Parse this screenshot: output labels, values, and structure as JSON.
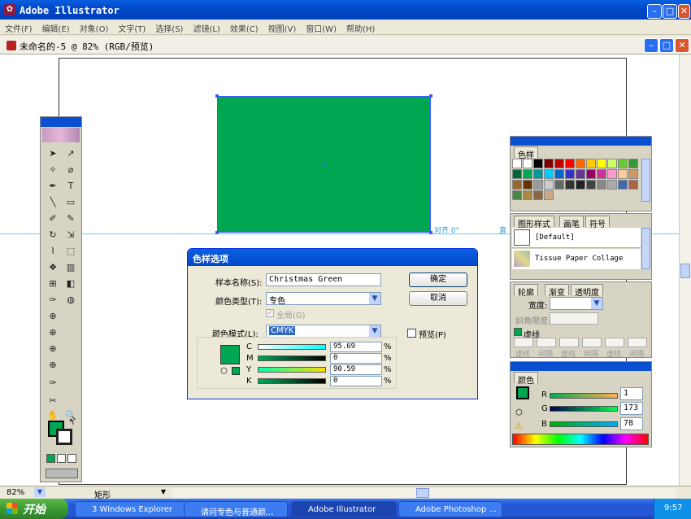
{
  "app": {
    "title": "Adobe Illustrator"
  },
  "menu": [
    "文件(F)",
    "编辑(E)",
    "对象(O)",
    "文字(T)",
    "选择(S)",
    "滤镜(L)",
    "效果(C)",
    "视图(V)",
    "窗口(W)",
    "帮助(H)"
  ],
  "document": {
    "title": "未命名的-5 @ 82% (RGB/预览)"
  },
  "canvas_guides": {
    "align_label": "对齐 0°",
    "guide_label": "直"
  },
  "colors": {
    "spot_green": "#00a651",
    "selection_blue": "#3b5bff",
    "titlebar": "#0052e0"
  },
  "swatches_panel": {
    "tab": "色样"
  },
  "styles_panel": {
    "tabs": [
      "图形样式",
      "画笔",
      "符号"
    ],
    "items": [
      "[Default]",
      "Tissue Paper Collage"
    ]
  },
  "stroke_panel": {
    "tabs": [
      "轮廓",
      "渐变",
      "透明度"
    ],
    "width_label": "宽度:",
    "miter_label": "斜角限度:",
    "dashed_label": "虚线",
    "dash_labels": [
      "虚线",
      "间隔",
      "虚线",
      "间隔",
      "虚线",
      "间隔"
    ]
  },
  "color_panel": {
    "tab": "颜色",
    "r_label": "R",
    "g_label": "G",
    "b_label": "B",
    "r": "1",
    "g": "173",
    "b": "78"
  },
  "dialog": {
    "title": "色样选项",
    "name_label": "样本名称(S):",
    "name_value": "Christmas Green",
    "type_label": "颜色类型(T):",
    "type_value": "专色",
    "global_label": "全局(G)",
    "mode_label": "颜色模式(L):",
    "mode_value": "CMYK",
    "preview_label": "预览(P)",
    "ok": "确定",
    "cancel": "取消",
    "channels": [
      {
        "name": "C",
        "value": "95.69",
        "pct": "%"
      },
      {
        "name": "M",
        "value": "0",
        "pct": "%"
      },
      {
        "name": "Y",
        "value": "90.59",
        "pct": "%"
      },
      {
        "name": "K",
        "value": "0",
        "pct": "%"
      }
    ]
  },
  "status": {
    "zoom": "82%",
    "tool": "矩形"
  },
  "taskbar": {
    "start": "开始",
    "items": [
      "3 Windows Explorer",
      "请问专色与普通颜...",
      "Adobe Illustrator",
      "Adobe Photoshop ..."
    ],
    "clock": "9:57"
  }
}
